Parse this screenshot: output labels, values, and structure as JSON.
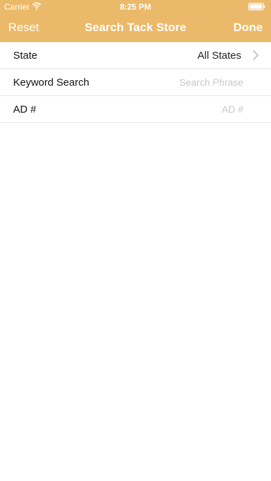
{
  "status_bar": {
    "carrier": "Carrier",
    "time": "8:25 PM",
    "icons": [
      "wifi-icon",
      "battery-icon"
    ]
  },
  "nav": {
    "left": "Reset",
    "title": "Search Tack Store",
    "right": "Done",
    "bar_color": "#ebb96a"
  },
  "form": {
    "state": {
      "label": "State",
      "value": "All States"
    },
    "keyword": {
      "label": "Keyword Search",
      "placeholder": "Search Phrase",
      "value": ""
    },
    "ad": {
      "label": "AD #",
      "placeholder": "AD #",
      "value": ""
    }
  }
}
